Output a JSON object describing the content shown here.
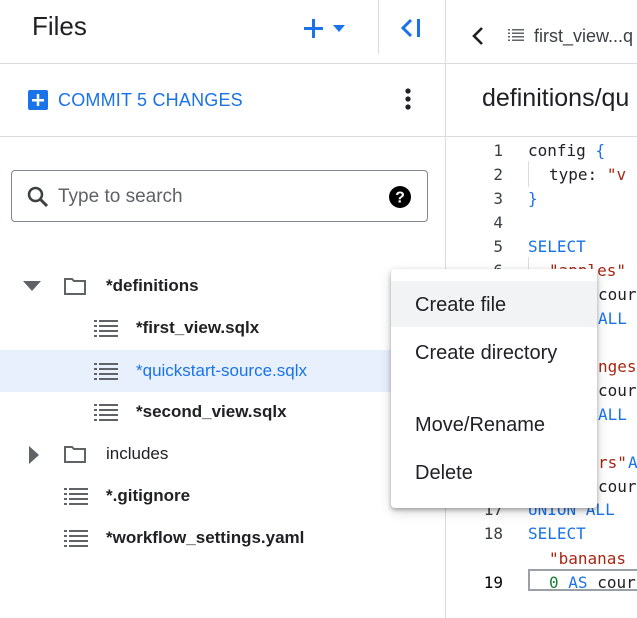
{
  "header": {
    "title": "Files",
    "add_icon": "plus-icon",
    "dropdown_icon": "caret-down-icon",
    "collapse_icon": "collapse-left-icon"
  },
  "commit": {
    "label": "COMMIT 5 CHANGES",
    "icon": "plus-square-icon"
  },
  "search": {
    "placeholder": "Type to search",
    "value": ""
  },
  "tree": [
    {
      "label": "*definitions",
      "type": "folder",
      "expanded": true
    },
    {
      "label": "*first_view.sqlx",
      "type": "file"
    },
    {
      "label": "*quickstart-source.sqlx",
      "type": "file",
      "selected": true
    },
    {
      "label": "*second_view.sqlx",
      "type": "file"
    },
    {
      "label": "includes",
      "type": "folder",
      "expanded": false
    },
    {
      "label": "*.gitignore",
      "type": "file"
    },
    {
      "label": "*workflow_settings.yaml",
      "type": "file"
    }
  ],
  "editor": {
    "tab_label": "first_view...q",
    "path": "definitions/qu",
    "line_numbers": [
      "1",
      "2",
      "3",
      "4",
      "5",
      "6",
      "",
      "",
      "",
      "",
      "",
      "",
      "",
      "",
      "",
      "",
      "17",
      "18",
      "19"
    ],
    "code": {
      "l1a": "config",
      "l1b": "{",
      "l2a": "type:",
      "l2b": "\"v",
      "l3": "}",
      "l5": "SELECT",
      "l6": "\"apples\"",
      "l7": "cour",
      "l8": "ALL",
      "l9": "nges",
      "l10": "cour",
      "l11": "ALL",
      "l13": "rs\"",
      "l13b": "A",
      "l14": "cour",
      "l16": "UNION ALL",
      "l17": "SELECT",
      "l18": "\"bananas",
      "l19a": "0",
      "l19b": "AS",
      "l19c": "cour"
    }
  },
  "context_menu": {
    "items": [
      "Create file",
      "Create directory",
      "Move/Rename",
      "Delete"
    ]
  },
  "colors": {
    "accent": "#1a73e8",
    "selected_bg": "#e8f0fe"
  }
}
